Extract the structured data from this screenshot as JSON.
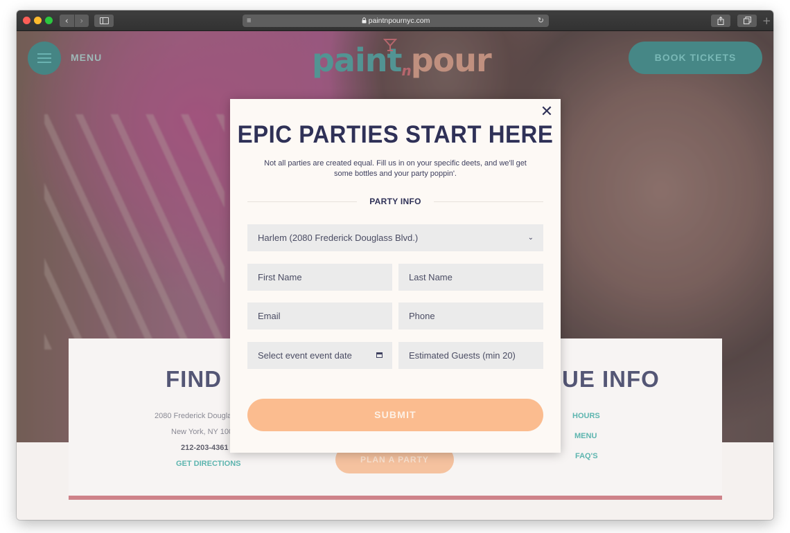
{
  "browser": {
    "url": "paintnpournyc.com",
    "nav_back": "‹",
    "nav_forward": "›"
  },
  "site": {
    "menu_label": "MENU",
    "logo_left": "paint",
    "logo_mid": "n",
    "logo_right": "pour",
    "book_button": "BOOK TICKETS"
  },
  "modal": {
    "title": "EPIC PARTIES START HERE",
    "subtitle": "Not all parties are created equal. Fill us in on your specific deets, and we'll get some bottles and your party poppin'.",
    "section_label": "PARTY INFO",
    "location_select": "Harlem (2080 Frederick Douglass Blvd.)",
    "first_name": "First Name",
    "last_name": "Last Name",
    "email": "Email",
    "phone": "Phone",
    "event_date": "Select event event date",
    "guests": "Estimated Guests (min 20)",
    "submit": "SUBMIT",
    "close": "✕"
  },
  "background_card": {
    "find_title": "FIND U",
    "venue_title": "UE INFO",
    "address_line1": "2080 Frederick Dougla",
    "address_line2": "New York, NY 100",
    "phone": "212-203-4361",
    "directions": "GET DIRECTIONS",
    "plan_button": "PLAN A PARTY",
    "venue_links": [
      "HOURS",
      "MENU",
      "FAQ'S"
    ]
  },
  "colors": {
    "navy": "#2f3157",
    "teal": "#1e6d6c",
    "peach": "#fbbc8f",
    "modal_bg": "#fdf9f5",
    "field_bg": "#ebebeb"
  },
  "icons": [
    "close-icon",
    "chevron-down-icon",
    "calendar-icon",
    "hamburger-icon",
    "lock-icon",
    "reload-icon",
    "share-icon",
    "tabs-icon",
    "sidebar-icon",
    "reader-icon"
  ]
}
